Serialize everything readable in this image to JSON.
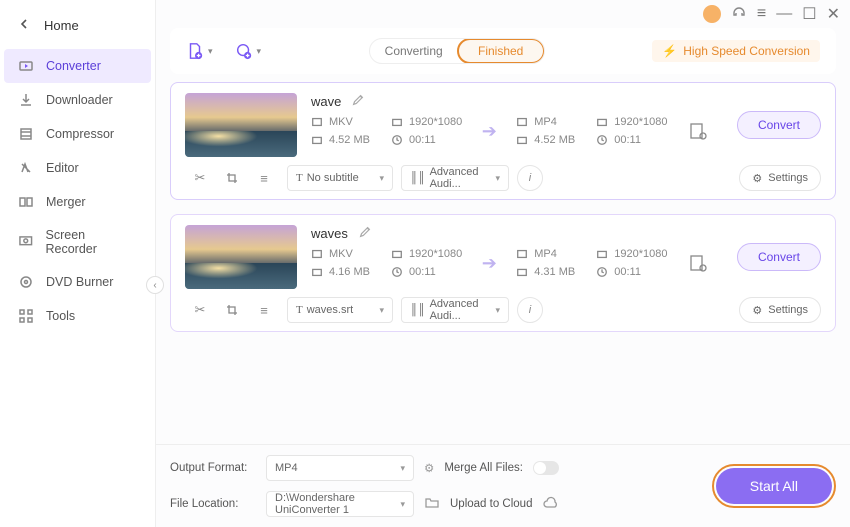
{
  "sidebar": {
    "home": "Home",
    "items": [
      {
        "label": "Converter"
      },
      {
        "label": "Downloader"
      },
      {
        "label": "Compressor"
      },
      {
        "label": "Editor"
      },
      {
        "label": "Merger"
      },
      {
        "label": "Screen Recorder"
      },
      {
        "label": "DVD Burner"
      },
      {
        "label": "Tools"
      }
    ]
  },
  "tabs": {
    "converting": "Converting",
    "finished": "Finished"
  },
  "highspeed": "High Speed Conversion",
  "items": [
    {
      "title": "wave",
      "src": {
        "fmt": "MKV",
        "res": "1920*1080",
        "size": "4.52 MB",
        "dur": "00:11"
      },
      "dst": {
        "fmt": "MP4",
        "res": "1920*1080",
        "size": "4.52 MB",
        "dur": "00:11"
      },
      "subtitle": "No subtitle",
      "audio": "Advanced Audi...",
      "convert": "Convert",
      "settings": "Settings"
    },
    {
      "title": "waves",
      "src": {
        "fmt": "MKV",
        "res": "1920*1080",
        "size": "4.16 MB",
        "dur": "00:11"
      },
      "dst": {
        "fmt": "MP4",
        "res": "1920*1080",
        "size": "4.31 MB",
        "dur": "00:11"
      },
      "subtitle": "waves.srt",
      "audio": "Advanced Audi...",
      "convert": "Convert",
      "settings": "Settings"
    }
  ],
  "footer": {
    "output_format_label": "Output Format:",
    "output_format_value": "MP4",
    "file_location_label": "File Location:",
    "file_location_value": "D:\\Wondershare UniConverter 1",
    "merge_label": "Merge All Files:",
    "upload_label": "Upload to Cloud",
    "start_all": "Start All"
  }
}
